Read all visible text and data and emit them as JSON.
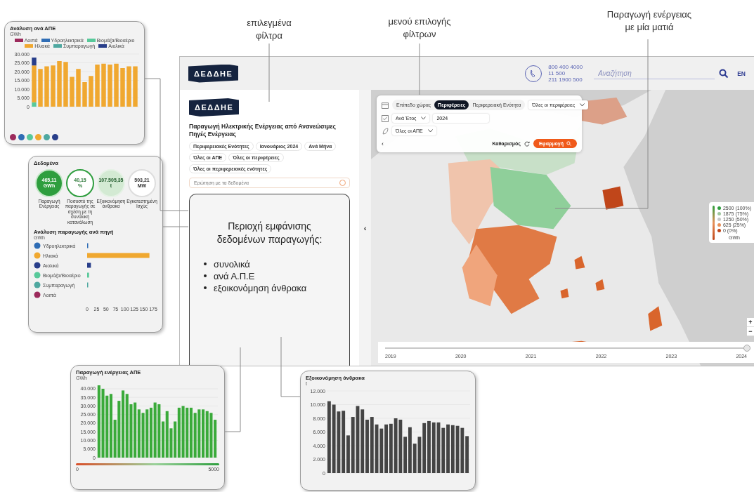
{
  "annotations": [
    {
      "text": "επιλεγμένα\nφίλτρα"
    },
    {
      "text": "μενού επιλογής\nφίλτρων"
    },
    {
      "text": "Παραγωγή ενέργειας\nμε μία ματιά"
    }
  ],
  "source_card": {
    "title": "Ανάλυση ανά ΑΠΕ",
    "unit": "GWh",
    "chart_data": {
      "type": "bar",
      "stacked": true,
      "grid": true,
      "ylim": [
        0,
        30000
      ],
      "yticks": [
        {
          "value": 0,
          "label": "0"
        },
        {
          "value": 5000,
          "label": "5.000"
        },
        {
          "value": 10000,
          "label": "10.000"
        },
        {
          "value": 15000,
          "label": "15.000"
        },
        {
          "value": 20000,
          "label": "20.000"
        },
        {
          "value": 25000,
          "label": "25.000"
        },
        {
          "value": 30000,
          "label": "30.000"
        }
      ],
      "series": [
        {
          "name": "Λοιπά",
          "color": "#9c2a5c",
          "values": [
            0,
            0,
            0,
            0,
            0,
            0,
            0,
            0,
            0,
            0,
            0,
            0,
            0,
            0,
            0,
            0,
            0
          ]
        },
        {
          "name": "Υδροηλεκτρικά",
          "color": "#2f6db5",
          "values": [
            0,
            0,
            0,
            0,
            0,
            0,
            0,
            0,
            0,
            0,
            0,
            0,
            0,
            0,
            0,
            0,
            0
          ]
        },
        {
          "name": "Βιομάζα/Βιοαέριο",
          "color": "#58c99a",
          "values": [
            2500,
            0,
            0,
            0,
            0,
            0,
            0,
            0,
            0,
            0,
            0,
            0,
            0,
            0,
            0,
            0,
            0
          ]
        },
        {
          "name": "Ηλιακά",
          "color": "#f0a830",
          "values": [
            21000,
            21500,
            23000,
            23500,
            26000,
            25500,
            17000,
            21500,
            14000,
            17500,
            24000,
            24500,
            24000,
            24500,
            22000,
            23000,
            23000
          ]
        },
        {
          "name": "Συμπαραγωγή",
          "color": "#4fa8a0",
          "values": [
            0,
            0,
            0,
            0,
            0,
            0,
            0,
            0,
            0,
            0,
            0,
            0,
            0,
            0,
            0,
            0,
            0
          ]
        },
        {
          "name": "Αιολικά",
          "color": "#283e8a",
          "values": [
            4500,
            0,
            0,
            0,
            0,
            0,
            0,
            0,
            0,
            0,
            0,
            0,
            0,
            0,
            0,
            0,
            0
          ]
        }
      ]
    }
  },
  "kpi_card": {
    "title": "Δεδομένα",
    "kpis": [
      {
        "kind": "solid",
        "value": "465,11\nGWh",
        "label": "Παραγωγή Ενέργειας"
      },
      {
        "kind": "ring",
        "value": "40,15\n%",
        "label": "Ποσοστό της παραγωγής σε σχέση με τη συνολική κατανάλωση"
      },
      {
        "kind": "soft",
        "value": "107.505,35\nt",
        "label": "Εξοικονόμηση άνθρακα"
      },
      {
        "kind": "plain",
        "value": "503,21\nMW",
        "label": "Εγκατεστημένη Ισχύς"
      }
    ],
    "breakdown_title": "Ανάλυση παραγωγής ανά πηγή",
    "breakdown_unit": "GWh",
    "chart_data": {
      "type": "bar",
      "orientation": "horizontal",
      "xlim": [
        0,
        175
      ],
      "categories": [
        "Υδροηλεκτρικά",
        "Ηλιακά",
        "Αιολικά",
        "Βιομάζα/Βιοαέριο",
        "Συμπαραγωγή",
        "Λοιπά"
      ],
      "colors": [
        "#2f6db5",
        "#f0a830",
        "#283e8a",
        "#58c99a",
        "#4fa8a0",
        "#9c2a5c"
      ],
      "values": [
        1,
        165,
        10,
        5,
        1,
        0
      ],
      "xticks": [
        0,
        25,
        50,
        75,
        100,
        125,
        150,
        175
      ]
    }
  },
  "production_card": {
    "title": "Παραγωγή ενέργειας ΑΠΕ",
    "unit": "GWh",
    "scale_min": "0",
    "scale_max": "5000",
    "chart_data": {
      "type": "bar",
      "grid": true,
      "ylim": [
        0,
        42000
      ],
      "color": "#3aaa3a",
      "yticks": [
        {
          "value": 0,
          "label": "0"
        },
        {
          "value": 5000,
          "label": "5.000"
        },
        {
          "value": 10000,
          "label": "10.000"
        },
        {
          "value": 15000,
          "label": "15.000"
        },
        {
          "value": 20000,
          "label": "20.000"
        },
        {
          "value": 25000,
          "label": "25.000"
        },
        {
          "value": 30000,
          "label": "30.000"
        },
        {
          "value": 35000,
          "label": "35.000"
        },
        {
          "value": 40000,
          "label": "40.000"
        }
      ],
      "values": [
        42000,
        40000,
        36000,
        37000,
        22000,
        33000,
        39000,
        37000,
        31000,
        32000,
        28000,
        26000,
        28000,
        29000,
        32000,
        31000,
        21000,
        27000,
        17000,
        21000,
        29000,
        30000,
        29000,
        29000,
        26000,
        28000,
        28000,
        27000,
        26000,
        22000
      ]
    }
  },
  "coal_card": {
    "title": "Εξοικονόμηση άνθρακα",
    "unit": "t",
    "chart_data": {
      "type": "bar",
      "grid": true,
      "ylim": [
        0,
        12000
      ],
      "color": "#444444",
      "yticks": [
        {
          "value": 0,
          "label": "0"
        },
        {
          "value": 2000,
          "label": "2.000"
        },
        {
          "value": 4000,
          "label": "4.000"
        },
        {
          "value": 6000,
          "label": "6.000"
        },
        {
          "value": 8000,
          "label": "8.000"
        },
        {
          "value": 10000,
          "label": "10.000"
        },
        {
          "value": 12000,
          "label": "12.000"
        }
      ],
      "values": [
        10500,
        10000,
        9000,
        9100,
        5500,
        8200,
        9800,
        9300,
        7800,
        8200,
        7100,
        6500,
        7100,
        7200,
        8000,
        7800,
        5300,
        6700,
        4300,
        5300,
        7300,
        7600,
        7400,
        7400,
        6600,
        7100,
        7000,
        6900,
        6600,
        5400
      ]
    }
  },
  "header": {
    "logo": "ΔΕΔΔΗΕ",
    "phones": [
      "800 400 4000",
      "11 500",
      "211 1900 500"
    ],
    "search": {
      "placeholder": "Αναζήτηση"
    },
    "language": "EN"
  },
  "side_panel": {
    "logo": "ΔΕΔΔΗΕ",
    "title": "Παραγωγή Ηλεκτρικής Ενέργειας από Ανανεώσιμες Πηγές Ενέργειας",
    "chips": [
      "Περιφερειακές Ενότητες",
      "Ιανουάριος 2024",
      "Ανά Μήνα",
      "Όλες οι ΑΠΕ",
      "Όλες οι περιφέρειες",
      "Όλες οι περιφερειακές ενότητες"
    ],
    "question": {
      "placeholder": "Ερώτηση με τα δεδομένα"
    },
    "overlay": {
      "heading": "Περιοχή εμφάνισης δεδομένων παραγωγής:",
      "bullets": [
        "συνολικά",
        "ανά Α.Π.Ε",
        "εξοικονόμηση άνθρακα"
      ]
    },
    "collapse": "‹"
  },
  "filters": {
    "levels": [
      {
        "label": "Επίπεδο χώρας",
        "selected": false
      },
      {
        "label": "Περιφέρειες",
        "selected": true
      },
      {
        "label": "Περιφερειακή Ενότητα",
        "selected": false
      }
    ],
    "region": "Όλες οι περιφέρειες",
    "period": "Ανά Έτος",
    "year": "2024",
    "source": "Όλες οι ΑΠΕ",
    "back": "‹",
    "reset": "Καθαρισμός",
    "apply": "Εφαρμογή"
  },
  "legend": {
    "items": [
      {
        "label": "2500 (100%)",
        "color": "#2e9e3e"
      },
      {
        "label": "1875 (75%)",
        "color": "#a0c8a0"
      },
      {
        "label": "1250 (50%)",
        "color": "#c8c8c8"
      },
      {
        "label": "625 (25%)",
        "color": "#e8915a"
      },
      {
        "label": "0 (0%)",
        "color": "#c0461a"
      }
    ],
    "unit": "GWh"
  },
  "zoom": [
    "+",
    "−"
  ],
  "timeline": {
    "years": [
      "2019",
      "2020",
      "2021",
      "2022",
      "2023",
      "2024"
    ],
    "level": 1
  }
}
